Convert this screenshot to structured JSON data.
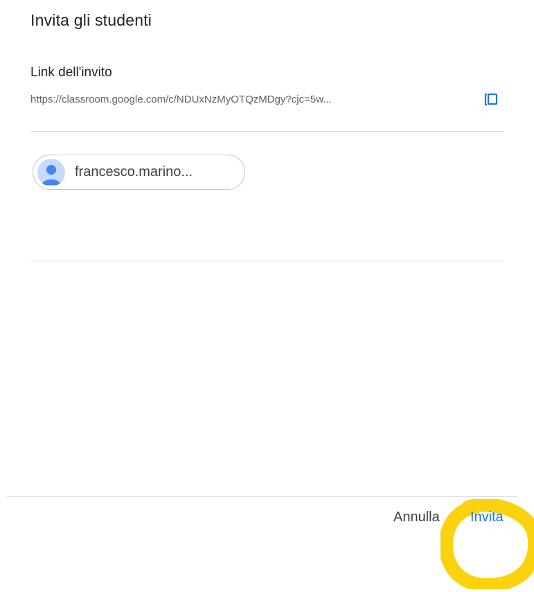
{
  "dialog": {
    "title": "Invita gli studenti"
  },
  "invite_link": {
    "label": "Link dell'invito",
    "url": "https://classroom.google.com/c/NDUxNzMyOTQzMDgy?cjc=5w...",
    "copy_icon": "copy-icon"
  },
  "recipients": [
    {
      "name": "francesco.marino...",
      "avatar_icon": "person-icon"
    }
  ],
  "actions": {
    "cancel_label": "Annulla",
    "invite_label": "Invita"
  },
  "colors": {
    "primary": "#1a73e8",
    "text": "#202124",
    "secondary_text": "#5f6368",
    "divider": "#dadce0",
    "avatar_bg": "#c6dafc",
    "avatar_fg": "#4285f4",
    "highlight": "#fcd20f"
  }
}
